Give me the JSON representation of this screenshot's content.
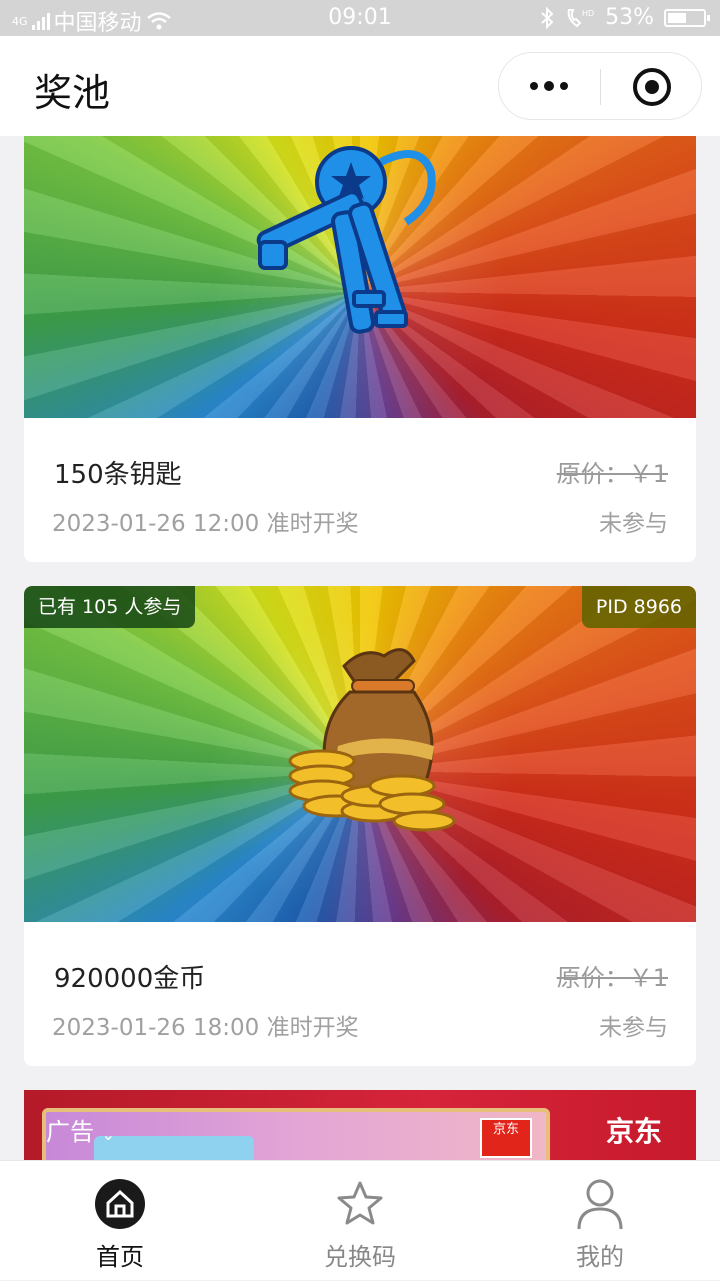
{
  "status_bar": {
    "carrier": "中国移动",
    "network": "4G",
    "time": "09:01",
    "battery": "53%",
    "battery_level": 0.53
  },
  "nav": {
    "title": "奖池"
  },
  "prizes": [
    {
      "name": "150条钥匙",
      "original_price": "原价：￥1",
      "draw_time": "2023-01-26 12:00 准时开奖",
      "join_state": "未参与",
      "image": "keys-icon"
    },
    {
      "name": "920000金币",
      "original_price": "原价：￥1",
      "draw_time": "2023-01-26 18:00 准时开奖",
      "join_state": "未参与",
      "participants": "已有 105 人参与",
      "pid": "PID 8966",
      "image": "coin-bag-icon"
    }
  ],
  "ad": {
    "label": "广告",
    "brand_small": "京东",
    "brand_big": "京东"
  },
  "tabs": [
    {
      "label": "首页",
      "icon": "home-icon",
      "active": true
    },
    {
      "label": "兑换码",
      "icon": "star-icon",
      "active": false
    },
    {
      "label": "我的",
      "icon": "person-icon",
      "active": false
    }
  ],
  "colors": {
    "active_tab": "#111111",
    "inactive_tab": "#888888",
    "muted_text": "#a0a0a0"
  }
}
